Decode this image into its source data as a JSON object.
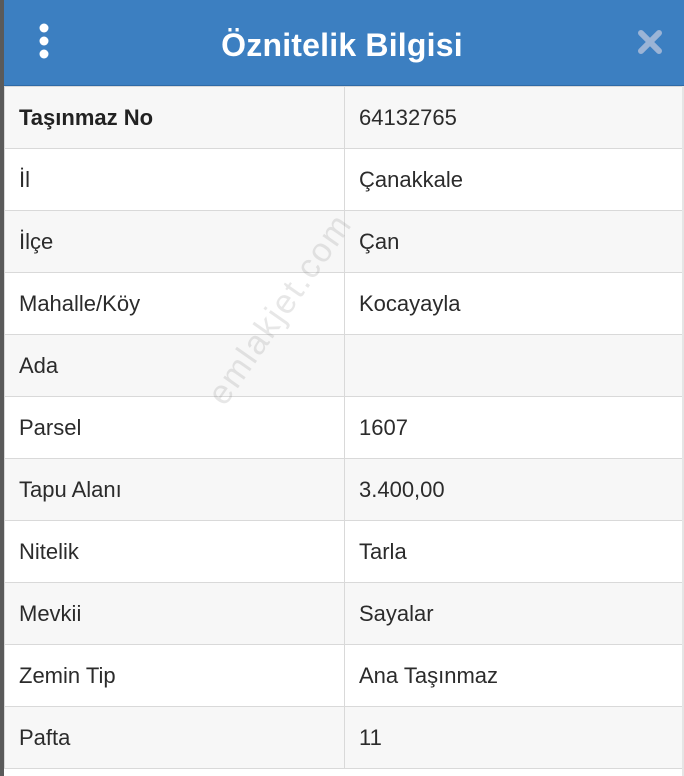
{
  "header": {
    "title": "Öznitelik Bilgisi",
    "menu_icon": "more-vertical-icon",
    "close_icon": "close-icon",
    "bg_color": "#3c7fc1"
  },
  "watermark": {
    "text": "emlakjet.com"
  },
  "rows": [
    {
      "key": "Taşınmaz No",
      "value": "64132765"
    },
    {
      "key": "İl",
      "value": "Çanakkale"
    },
    {
      "key": "İlçe",
      "value": "Çan"
    },
    {
      "key": "Mahalle/Köy",
      "value": "Kocayayla"
    },
    {
      "key": "Ada",
      "value": ""
    },
    {
      "key": "Parsel",
      "value": "1607"
    },
    {
      "key": "Tapu Alanı",
      "value": "3.400,00"
    },
    {
      "key": "Nitelik",
      "value": "Tarla"
    },
    {
      "key": "Mevkii",
      "value": "Sayalar"
    },
    {
      "key": "Zemin Tip",
      "value": "Ana Taşınmaz"
    },
    {
      "key": "Pafta",
      "value": "11"
    }
  ]
}
